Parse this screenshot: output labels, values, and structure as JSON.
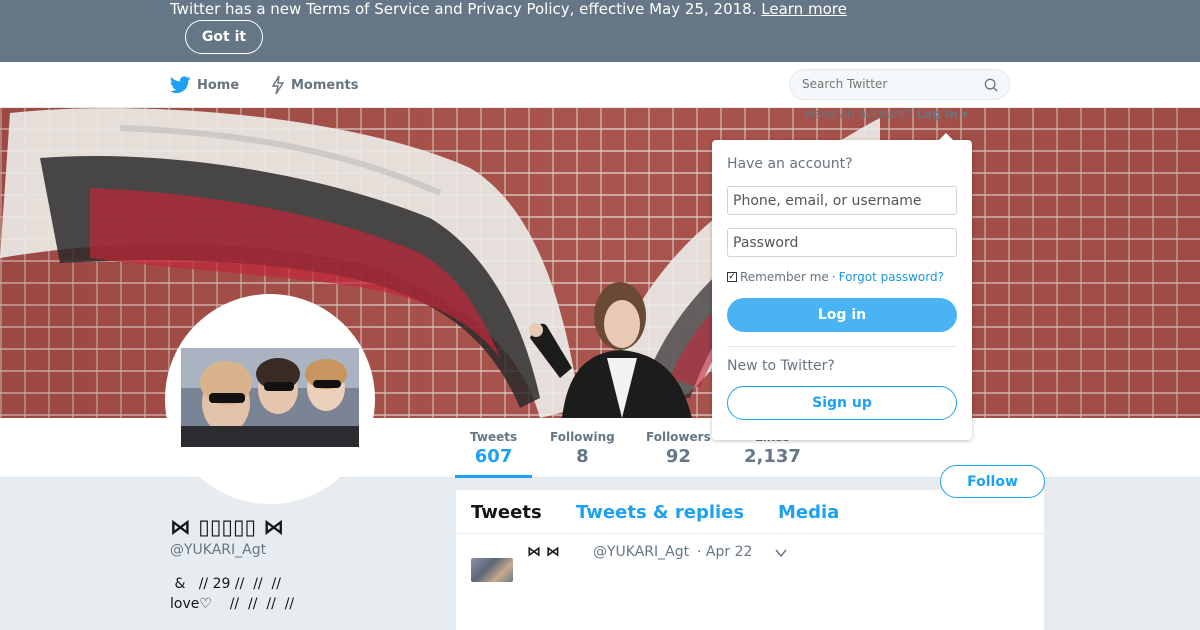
{
  "banner": {
    "text": "Twitter has a new Terms of Service and Privacy Policy, effective May 25, 2018.",
    "link": "Learn more",
    "button": "Got it"
  },
  "nav": {
    "home": "Home",
    "moments": "Moments",
    "search_placeholder": "Search Twitter",
    "account_prompt": "Have an account?",
    "login_link": "Log in"
  },
  "login": {
    "title": "Have an account?",
    "username_placeholder": "Phone, email, or username",
    "password_placeholder": "Password",
    "remember": "Remember me",
    "separator": "·",
    "forgot": "Forgot password?",
    "login_button": "Log in",
    "new_prompt": "New to Twitter?",
    "signup_button": "Sign up"
  },
  "stats": [
    {
      "label": "Tweets",
      "value": "607"
    },
    {
      "label": "Following",
      "value": "8"
    },
    {
      "label": "Followers",
      "value": "92"
    },
    {
      "label": "Likes",
      "value": "2,137"
    }
  ],
  "follow_button": "Follow",
  "profile": {
    "name": "⋈ ▯▯▯▯▯ ⋈",
    "handle": "@YUKARI_Agt",
    "bio": " &   // 29 //  //  //\nlove♡    //  //  //  //"
  },
  "timeline": {
    "tabs": [
      "Tweets",
      "Tweets & replies",
      "Media"
    ],
    "tweet": {
      "name": "⋈  ⋈",
      "handle": "@YUKARI_Agt",
      "time": "· Apr 22"
    }
  },
  "colors": {
    "accent": "#1da1f2",
    "banner": "#657786",
    "background": "#e6ecf0"
  }
}
